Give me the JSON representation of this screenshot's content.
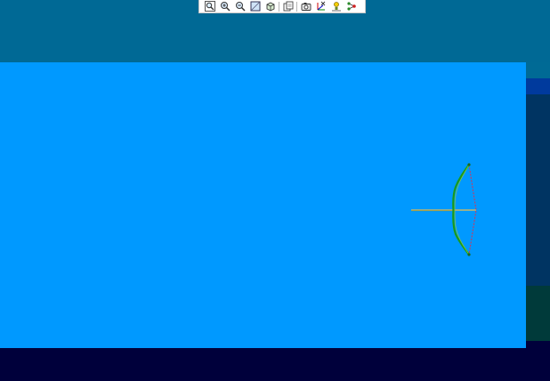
{
  "toolbar": {
    "buttons": [
      {
        "icon": "zoom-fit-icon"
      },
      {
        "icon": "zoom-in-icon"
      },
      {
        "icon": "zoom-out-icon"
      },
      {
        "icon": "view-2d-icon"
      },
      {
        "icon": "view-3d-icon"
      },
      {
        "icon": "copy-image-icon"
      },
      {
        "icon": "camera-icon"
      },
      {
        "icon": "axes-icon"
      },
      {
        "icon": "light-icon"
      },
      {
        "icon": "nodes-icon"
      }
    ]
  },
  "colors": {
    "viewport_bg": "#0099ff",
    "bow_limb": "#1a9a1a",
    "bow_string": "#e03050",
    "arrow_shaft": "#c8b86a"
  }
}
